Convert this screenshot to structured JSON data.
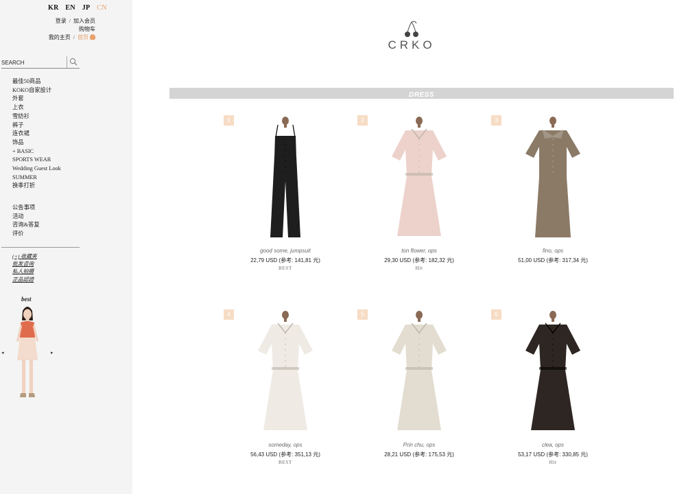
{
  "languages": [
    {
      "label": "KR",
      "active": false
    },
    {
      "label": "EN",
      "active": false
    },
    {
      "label": "JP",
      "active": false
    },
    {
      "label": "CN",
      "active": true
    }
  ],
  "account": {
    "login": "登录",
    "join": "加入会员",
    "cart": "购物车",
    "mypage": "我的主页",
    "home": "首页"
  },
  "search": {
    "placeholder": "SEARCH"
  },
  "menu": [
    "最佳50商品",
    "KOKO自家設计",
    "外套",
    "上衣",
    "雪纺衫",
    "裤子",
    "连衣裙",
    "饰品",
    "+ BASIC",
    "SPORTS WEAR",
    "Wedding Guest Look",
    "SUMMER",
    "换季打折"
  ],
  "board_menu": [
    "公告事项",
    "活动",
    "咨询&答复",
    "评价"
  ],
  "links": [
    "(+) 收藏夹",
    "批发咨询",
    "私人拍摄",
    "正品認證"
  ],
  "best": {
    "title": "best",
    "prev": "◂",
    "next": "▸"
  },
  "brand": {
    "name": "CRKO"
  },
  "category": {
    "title": "DRESS"
  },
  "products": [
    {
      "num": "1",
      "name": "good some, jumpsuit",
      "price": "22,79 USD (参考: 141,81 元)",
      "badge": "BEST",
      "color": "#1e1e1e",
      "shape": "jumpsuit"
    },
    {
      "num": "2",
      "name": "ton flower, ops",
      "price": "29,30 USD (参考: 182,32 元)",
      "badge": "Hit",
      "color": "#ecd2cb",
      "shape": "dress-long"
    },
    {
      "num": "3",
      "name": "fino, ops",
      "price": "51,00 USD (参考: 317,34 元)",
      "badge": "",
      "color": "#8b7a66",
      "shape": "dress-short"
    },
    {
      "num": "4",
      "name": "someday, ops",
      "price": "56,43 USD (参考: 351,13 元)",
      "badge": "BEST",
      "color": "#efeae4",
      "shape": "dress-long"
    },
    {
      "num": "5",
      "name": "Prin chu, ops",
      "price": "28,21 USD (参考: 175,53 元)",
      "badge": "",
      "color": "#e2ddd0",
      "shape": "dress-long"
    },
    {
      "num": "6",
      "name": "clea, ops",
      "price": "53,17 USD (参考: 330,85 元)",
      "badge": "Hit",
      "color": "#2e2622",
      "shape": "dress-long"
    }
  ],
  "colors": {
    "accent": "#e8a06c",
    "sidebar_bg": "#f4f4f4",
    "category_bar": "#d4d4d4",
    "number_badge": "#f6dcc4"
  }
}
